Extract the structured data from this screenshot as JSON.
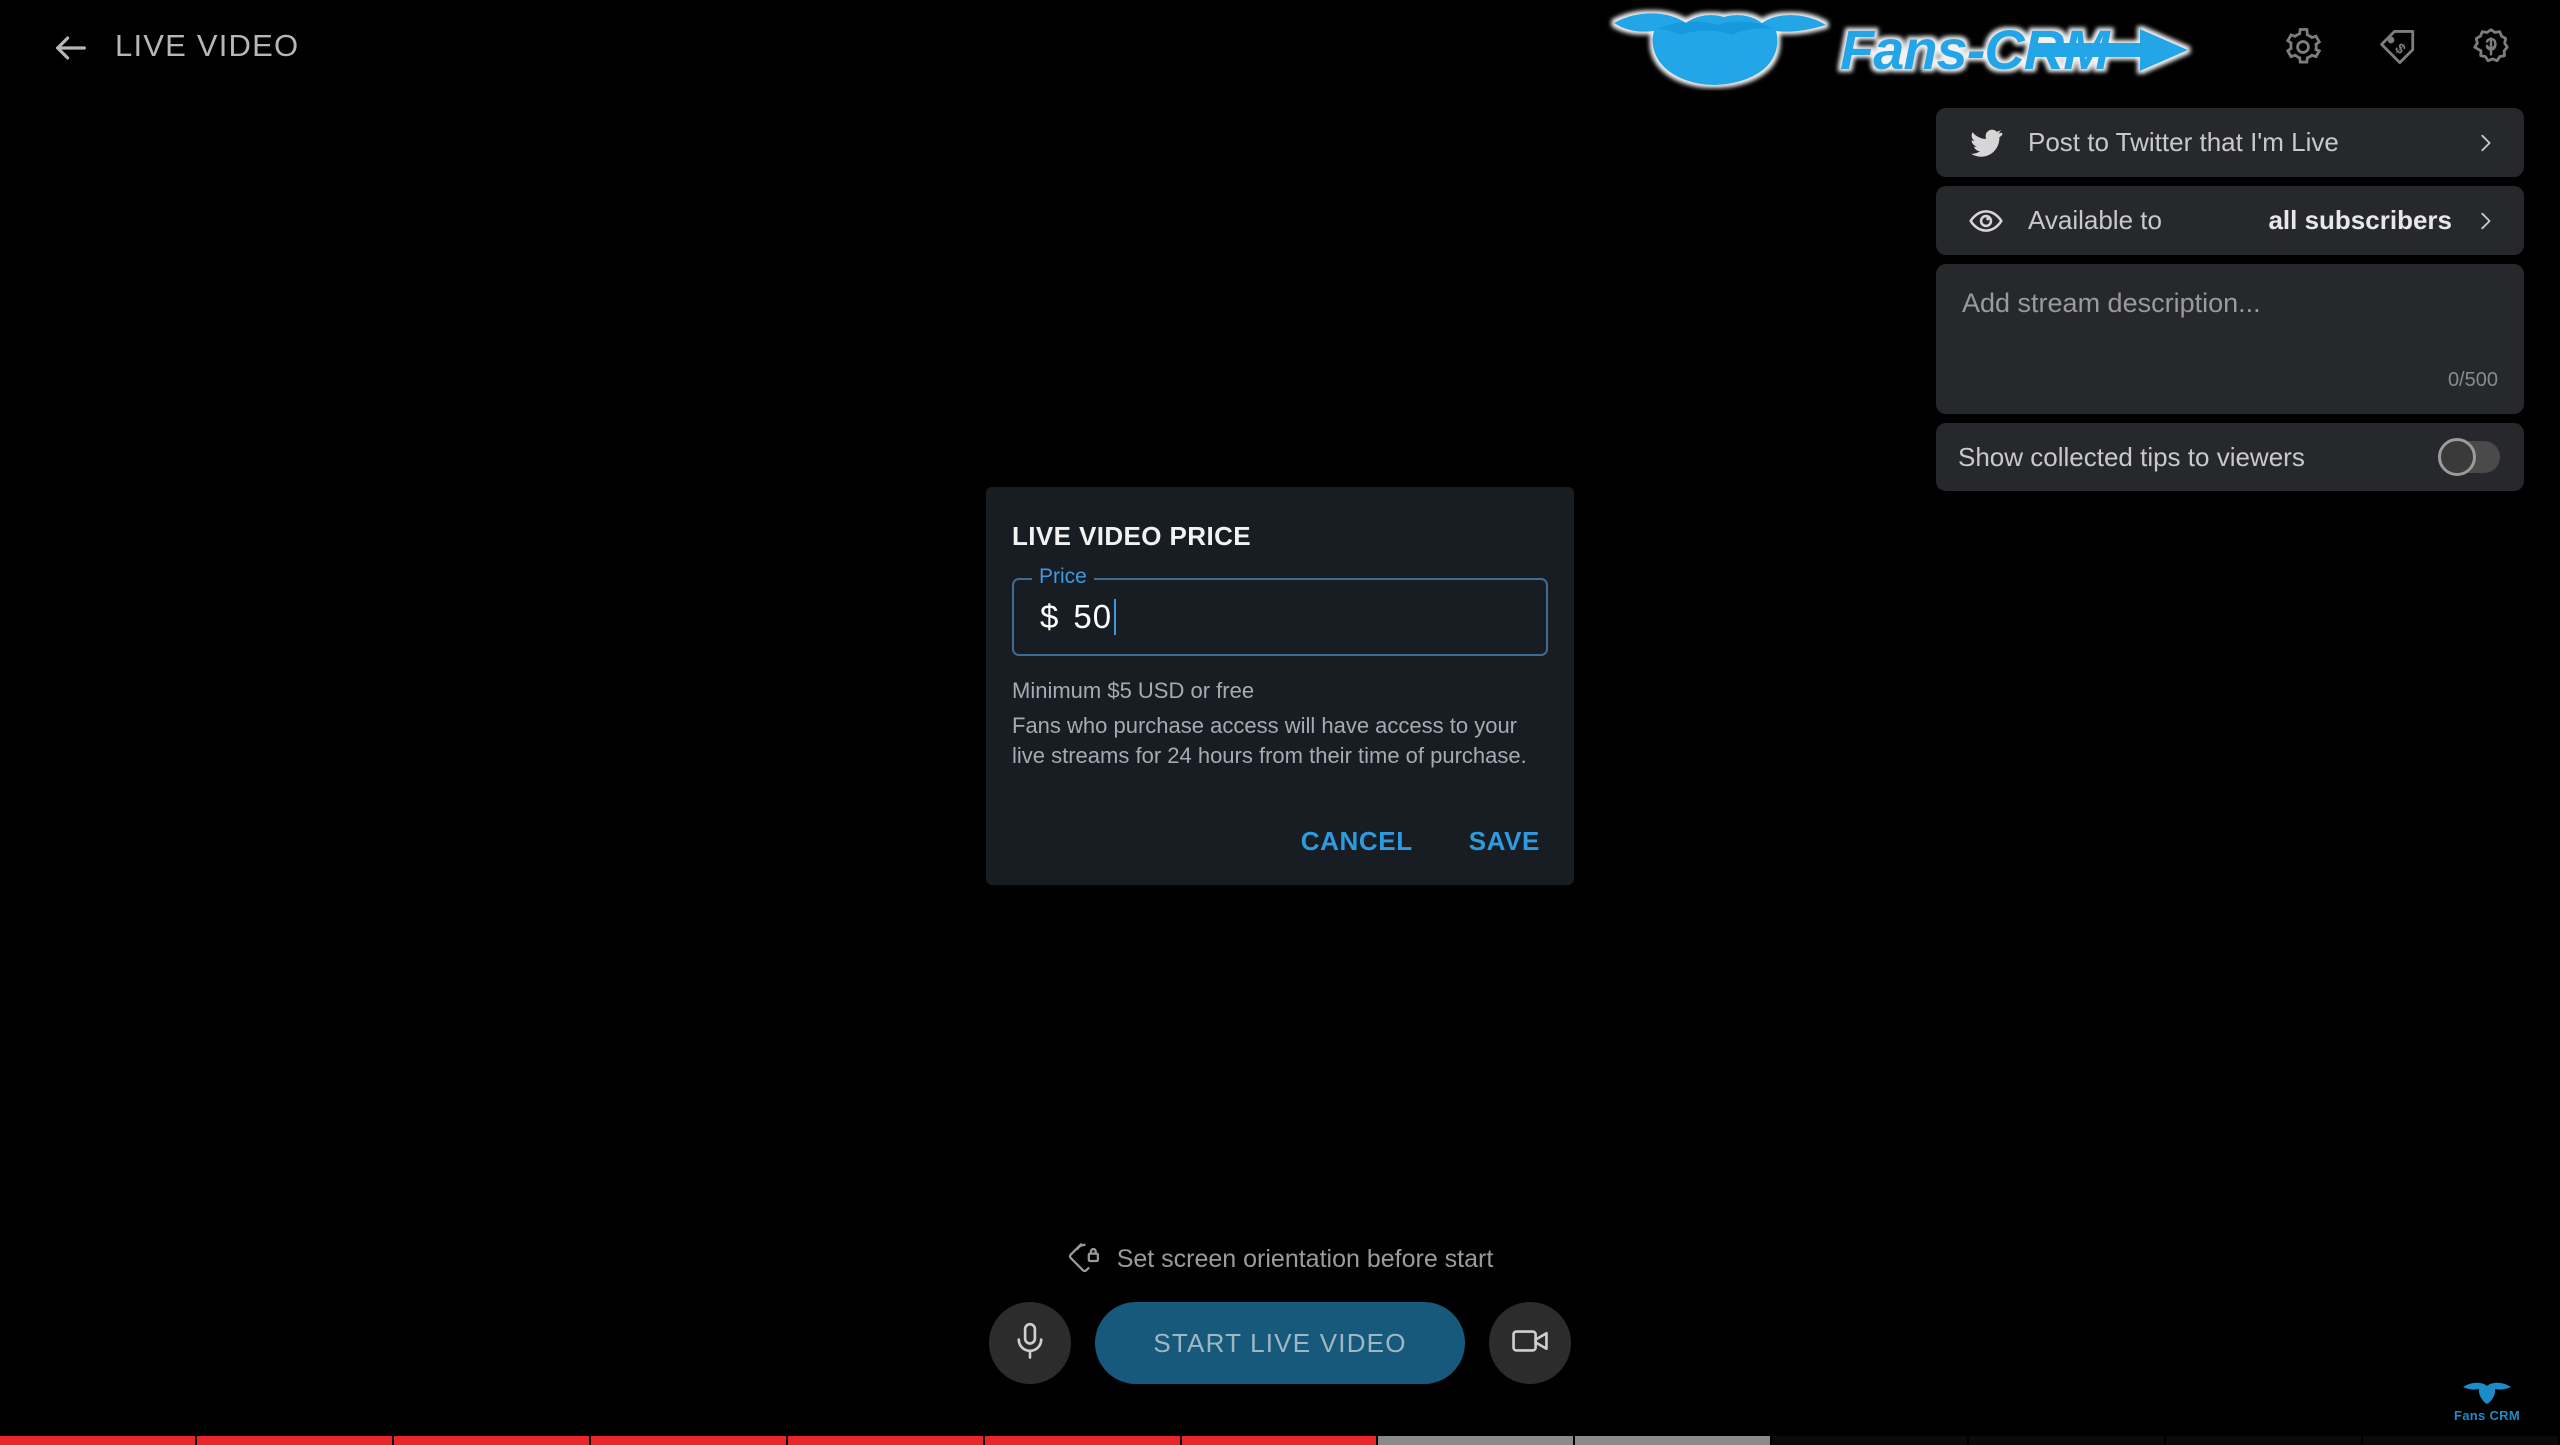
{
  "header": {
    "back_icon": "arrow-back-icon",
    "title": "LIVE VIDEO",
    "logo_text": "Fans-CRM",
    "icons": [
      {
        "name": "settings-gear-icon",
        "label": "Settings"
      },
      {
        "name": "price-tag-icon",
        "label": "Price tag"
      },
      {
        "name": "earnings-badge-icon",
        "label": "Earnings"
      }
    ]
  },
  "right_panel": {
    "twitter_row": {
      "icon": "twitter-bird-icon",
      "label": "Post to Twitter that I'm Live",
      "chevron": "chevron-right-icon"
    },
    "availability_row": {
      "icon": "eye-icon",
      "label": "Available to",
      "value": "all subscribers",
      "chevron": "chevron-right-icon"
    },
    "description": {
      "placeholder": "Add stream description...",
      "value": "",
      "counter": "0/500"
    },
    "tips_toggle": {
      "label": "Show collected tips to viewers",
      "state": "off"
    }
  },
  "dialog": {
    "title": "LIVE VIDEO PRICE",
    "field_label": "Price",
    "currency_symbol": "$",
    "value": "50",
    "helper_line1": "Minimum $5 USD or free",
    "helper_line2": "Fans who purchase access will have access to your live streams for 24 hours from their time of purchase.",
    "cancel_label": "CANCEL",
    "save_label": "SAVE"
  },
  "bottom": {
    "orientation_icon": "screen-rotation-lock-icon",
    "orientation_hint": "Set screen orientation before start",
    "mic_icon": "microphone-icon",
    "start_label": "START LIVE VIDEO",
    "camera_icon": "video-camera-icon"
  },
  "watermark": {
    "text": "Fans CRM",
    "icon": "fans-crm-bird-icon"
  },
  "colors": {
    "accent_blue": "#2e9be0",
    "start_button": "#17597a",
    "card_bg": "#26282b",
    "dialog_bg": "#181c23",
    "field_border": "#3f6c8f",
    "progress_red": "#e8262a",
    "progress_gray": "#8a8a8a"
  },
  "progress": {
    "filled_percent": 67,
    "segment_count": 13
  }
}
